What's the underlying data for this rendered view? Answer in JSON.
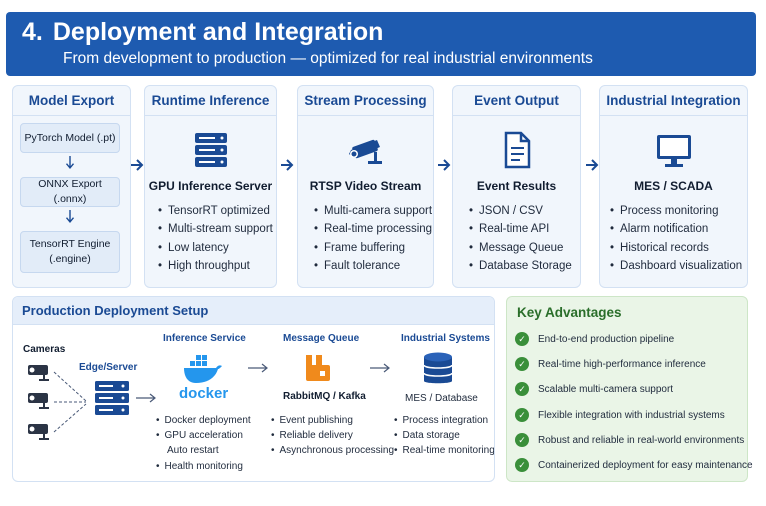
{
  "header": {
    "number": "4.",
    "title": "Deployment and Integration",
    "subtitle": "From development to production — optimized for real industrial environments"
  },
  "pipeline": {
    "model_export": {
      "title": "Model Export",
      "steps": [
        "PyTorch Model (.pt)",
        "ONNX Export (.onnx)",
        "TensorRT Engine (.engine)"
      ]
    },
    "runtime_inference": {
      "title": "Runtime Inference",
      "icon": "server-icon",
      "name": "GPU Inference Server",
      "items": [
        "TensorRT optimized",
        "Multi-stream support",
        "Low latency",
        "High throughput"
      ]
    },
    "stream_processing": {
      "title": "Stream Processing",
      "icon": "camera-icon",
      "name": "RTSP Video Stream",
      "items": [
        "Multi-camera support",
        "Real-time processing",
        "Frame buffering",
        "Fault tolerance"
      ]
    },
    "event_output": {
      "title": "Event Output",
      "icon": "document-icon",
      "name": "Event Results",
      "items": [
        "JSON / CSV",
        "Real-time API",
        "Message Queue",
        "Database Storage"
      ]
    },
    "industrial_integration": {
      "title": "Industrial Integration",
      "icon": "monitor-icon",
      "name": "MES / SCADA",
      "items": [
        "Process monitoring",
        "Alarm notification",
        "Historical records",
        "Dashboard visualization"
      ]
    }
  },
  "deployment": {
    "title": "Production Deployment Setup",
    "cameras_label": "Cameras",
    "edge_label": "Edge/Server",
    "inference_label": "Inference Service",
    "docker_text": "docker",
    "inference_items": [
      "Docker deployment",
      "GPU acceleration",
      "Auto restart",
      "Health monitoring"
    ],
    "queue_label": "Message Queue",
    "queue_name": "RabbitMQ / Kafka",
    "queue_items": [
      "Event publishing",
      "Reliable delivery",
      "Asynchronous processing"
    ],
    "industrial_label": "Industrial Systems",
    "industrial_name": "MES / Database",
    "industrial_items": [
      "Process integration",
      "Data storage",
      "Real-time monitoring"
    ]
  },
  "advantages": {
    "title": "Key Advantages",
    "items": [
      "End-to-end production pipeline",
      "Real-time high-performance inference",
      "Scalable multi-camera support",
      "Flexible integration with industrial systems",
      "Robust and reliable in real-world environments",
      "Containerized deployment for easy maintenance"
    ]
  },
  "colors": {
    "header_bg": "#1e5bb0",
    "accent_blue": "#1a4a94",
    "card_bg": "#f1f6fc",
    "advantage_green": "#3a8f3a",
    "queue_orange": "#f08a1c",
    "docker_blue": "#2496ed"
  }
}
